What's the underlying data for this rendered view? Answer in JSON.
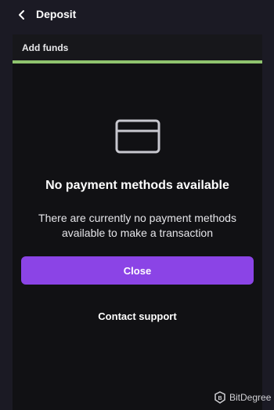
{
  "header": {
    "title": "Deposit",
    "back_icon": "chevron-left-icon"
  },
  "panel": {
    "section_title": "Add funds",
    "progress": 1.0,
    "progress_color": "#8fc46e"
  },
  "empty_state": {
    "icon": "credit-card-icon",
    "headline": "No payment methods available",
    "description": "There are currently no payment methods available to make a transaction"
  },
  "actions": {
    "close_label": "Close",
    "close_color": "#8b44e6",
    "support_label": "Contact support"
  },
  "watermark": {
    "text": "BitDegree",
    "logo": "bitdegree-logo"
  }
}
